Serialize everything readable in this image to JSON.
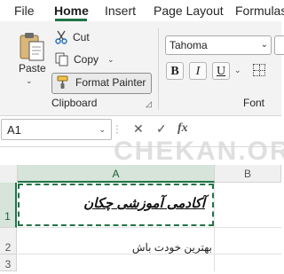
{
  "tabs": [
    "File",
    "Home",
    "Insert",
    "Page Layout",
    "Formulas"
  ],
  "active_tab": "Home",
  "clipboard": {
    "paste_label": "Paste",
    "cut_label": "Cut",
    "copy_label": "Copy",
    "format_painter_label": "Format Painter",
    "group_label": "Clipboard"
  },
  "font": {
    "font_name": "Tahoma",
    "bold_label": "B",
    "italic_label": "I",
    "underline_label": "U",
    "group_label": "Font"
  },
  "formula_bar": {
    "name_box": "A1",
    "fx_label": "fx"
  },
  "watermark": "CHEKAN.ORG",
  "sheet": {
    "columns": [
      "A",
      "B"
    ],
    "selected_column": "A",
    "rows": [
      "1",
      "2",
      "3"
    ],
    "selected_row": "1",
    "cells": {
      "A1": "آکادمی آموزشی چکان",
      "A2": "بهترین خودت باش"
    }
  },
  "colors": {
    "accent": "#217346",
    "ribbon_bg": "#f3f3f3",
    "header_bg": "#f0f0f0"
  }
}
